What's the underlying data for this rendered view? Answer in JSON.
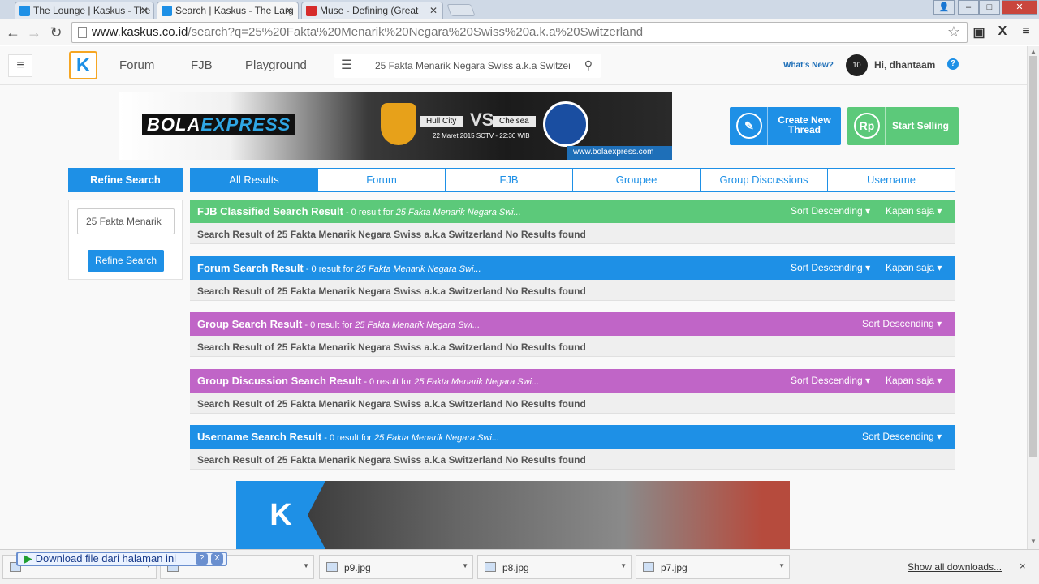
{
  "browser": {
    "tabs": [
      {
        "title": "The Lounge | Kaskus - The"
      },
      {
        "title": "Search | Kaskus - The Larg"
      },
      {
        "title": "Muse - Defining (Great"
      }
    ],
    "url_host": "www.kaskus.co.id",
    "url_path": "/search?q=25%20Fakta%20Menarik%20Negara%20Swiss%20a.k.a%20Switzerland"
  },
  "header": {
    "logo": "K",
    "nav": [
      "Forum",
      "FJB",
      "Playground"
    ],
    "search_value": "25 Fakta Menarik Negara Swiss a.k.a Switzer",
    "whats_new": "What's New?",
    "avatar_text": "10",
    "greeting": "Hi, dhantaam",
    "help": "?"
  },
  "banner": {
    "brand_a": "BOLA",
    "brand_b": "EXPRESS",
    "team1": "Hull City",
    "vs": "VS",
    "team2": "Chelsea",
    "date": "22 Maret 2015 SCTV - 22:30 WIB",
    "url": "www.bolaexpress.com"
  },
  "cta": {
    "create_line1": "Create New",
    "create_line2": "Thread",
    "sell": "Start Selling",
    "sell_icon": "Rp"
  },
  "refine": {
    "title": "Refine Search",
    "input_value": "25 Fakta Menarik",
    "button": "Refine Search"
  },
  "tabs": [
    "All Results",
    "Forum",
    "FJB",
    "Groupee",
    "Group Discussions",
    "Username"
  ],
  "sections": [
    {
      "title": "FJB Classified Search Result",
      "count": " - 0 result for ",
      "query": "25 Fakta Menarik Negara Swi...",
      "sort": "Sort Descending",
      "time": "Kapan saja",
      "body": "Search Result of 25 Fakta Menarik Negara Swiss a.k.a Switzerland No Results found"
    },
    {
      "title": "Forum Search Result",
      "count": " - 0 result for ",
      "query": "25 Fakta Menarik Negara Swi...",
      "sort": "Sort Descending",
      "time": "Kapan saja",
      "body": "Search Result of 25 Fakta Menarik Negara Swiss a.k.a Switzerland No Results found"
    },
    {
      "title": "Group Search Result",
      "count": " - 0 result for ",
      "query": "25 Fakta Menarik Negara Swi...",
      "sort": "Sort Descending",
      "body": "Search Result of 25 Fakta Menarik Negara Swiss a.k.a Switzerland No Results found"
    },
    {
      "title": "Group Discussion Search Result",
      "count": " - 0 result for ",
      "query": "25 Fakta Menarik Negara Swi...",
      "sort": "Sort Descending",
      "time": "Kapan saja",
      "body": "Search Result of 25 Fakta Menarik Negara Swiss a.k.a Switzerland No Results found"
    },
    {
      "title": "Username Search Result",
      "count": " - 0 result for ",
      "query": "25 Fakta Menarik Negara Swi...",
      "sort": "Sort Descending",
      "body": "Search Result of 25 Fakta Menarik Negara Swiss a.k.a Switzerland No Results found"
    }
  ],
  "bottom_banner": {
    "logo": "K"
  },
  "downloads": {
    "popup": "Download file dari halaman ini",
    "popup_help": "?",
    "popup_close": "X",
    "items": [
      "p9.jpg",
      "p8.jpg",
      "p7.jpg"
    ],
    "show_all": "Show all downloads...",
    "close": "×"
  },
  "colors": {
    "blue": "#1e90e6",
    "green": "#5cc97a",
    "purple": "#c065c7"
  }
}
